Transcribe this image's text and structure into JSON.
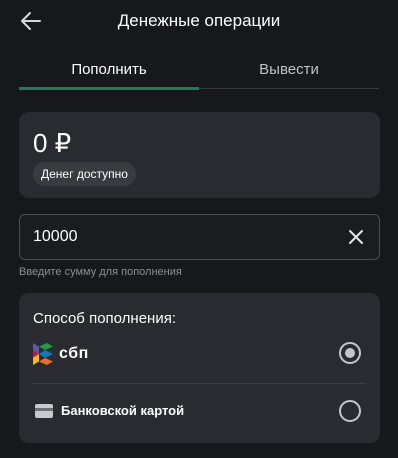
{
  "header": {
    "title": "Денежные операции",
    "back_icon": "arrow-left-icon"
  },
  "tabs": [
    {
      "label": "Пополнить",
      "active": true
    },
    {
      "label": "Вывести",
      "active": false
    }
  ],
  "balance": {
    "amount": "0 ₽",
    "caption": "Денег доступно"
  },
  "amount_input": {
    "value": "10000",
    "helper": "Введите сумму для пополнения",
    "clear_icon": "close-icon"
  },
  "methods": {
    "title": "Способ пополнения:",
    "options": [
      {
        "label": "сбп",
        "icon": "sbp-logo",
        "selected": true
      },
      {
        "label": "Банковской картой",
        "icon": "bank-card-icon",
        "selected": false
      }
    ]
  },
  "colors": {
    "accent": "#1f7a58",
    "background": "#17181c",
    "card": "#2a2b30"
  }
}
